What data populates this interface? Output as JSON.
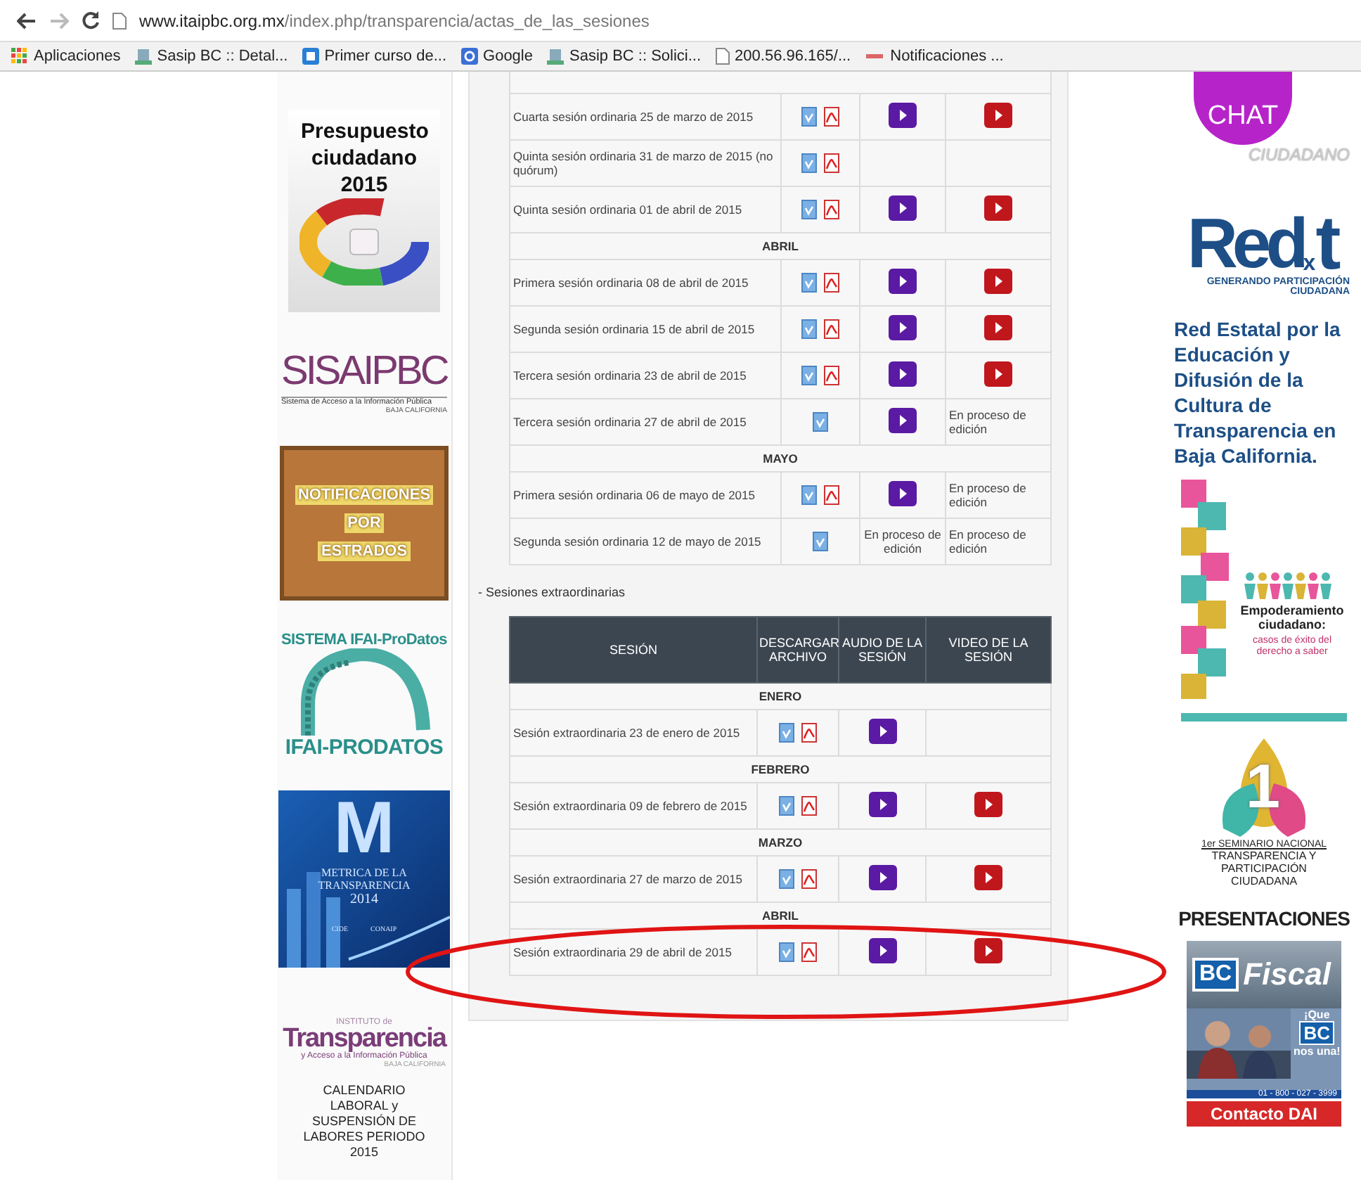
{
  "browser": {
    "url_host": "www.itaipbc.org.mx",
    "url_path": "/index.php/transparencia/actas_de_las_sesiones",
    "bookmarks": [
      {
        "label": "Aplicaciones",
        "kind": "apps"
      },
      {
        "label": "Sasip BC :: Detal...",
        "kind": "site"
      },
      {
        "label": "Primer curso de...",
        "kind": "gift"
      },
      {
        "label": "Google",
        "kind": "google"
      },
      {
        "label": "Sasip BC :: Solici...",
        "kind": "site"
      },
      {
        "label": "200.56.96.165/...",
        "kind": "page"
      },
      {
        "label": "Notificaciones ...",
        "kind": "pink"
      }
    ]
  },
  "left_sidebar": [
    {
      "kind": "budget",
      "texts": [
        "Presupuesto ciudadano 2015"
      ]
    },
    {
      "kind": "sisai",
      "texts": [
        "SISAIPBC",
        "Sistema de Acceso a la Información Pública",
        "BAJA CALIFORNIA"
      ]
    },
    {
      "kind": "board",
      "texts": [
        "NOTIFICACIONES",
        "POR",
        "ESTRADOS"
      ]
    },
    {
      "kind": "ifai",
      "texts": [
        "SISTEMA IFAI-ProDatos",
        "IFAI-PRODATOS"
      ]
    },
    {
      "kind": "metric",
      "texts": [
        "M",
        "METRICA DE LA TRANSPARENCIA",
        "2014",
        "CIDE",
        "CONAIP"
      ]
    },
    {
      "kind": "transparency",
      "texts": [
        "INSTITUTO de",
        "Transparencia",
        "y Acceso a la Información Pública",
        "BAJA CALIFORNIA"
      ]
    },
    {
      "kind": "calendar",
      "texts": [
        "CALENDARIO LABORAL y SUSPENSIÓN DE LABORES PERIODO 2015"
      ]
    }
  ],
  "ordinary_sessions": {
    "rows": [
      {
        "kind": "session",
        "text": "Cuarta sesión ordinaria 25 de marzo de 2015",
        "word": true,
        "pdf": true,
        "audio": {
          "kind": "play"
        },
        "video": {
          "kind": "play"
        }
      },
      {
        "kind": "session",
        "text": "Quinta sesión ordinaria 31 de marzo de 2015 (no quórum)",
        "word": true,
        "pdf": true
      },
      {
        "kind": "session",
        "text": "Quinta sesión ordinaria 01 de abril de 2015",
        "word": true,
        "pdf": true,
        "audio": {
          "kind": "play"
        },
        "video": {
          "kind": "play"
        }
      },
      {
        "kind": "month",
        "text": "ABRIL"
      },
      {
        "kind": "session",
        "text": "Primera sesión ordinaria 08 de abril de 2015",
        "word": true,
        "pdf": true,
        "audio": {
          "kind": "play"
        },
        "video": {
          "kind": "play"
        }
      },
      {
        "kind": "session",
        "text": "Segunda sesión ordinaria 15 de abril de 2015",
        "word": true,
        "pdf": true,
        "audio": {
          "kind": "play"
        },
        "video": {
          "kind": "play"
        }
      },
      {
        "kind": "session",
        "text": "Tercera sesión ordinaria 23 de abril de 2015",
        "word": true,
        "pdf": true,
        "audio": {
          "kind": "play"
        },
        "video": {
          "kind": "play"
        }
      },
      {
        "kind": "session",
        "text": "Tercera sesión ordinaria 27 de abril de 2015",
        "word": true,
        "pdf": false,
        "audio": {
          "kind": "play"
        },
        "video": {
          "kind": "text",
          "text": "En proceso de edición"
        }
      },
      {
        "kind": "month",
        "text": "MAYO"
      },
      {
        "kind": "session",
        "text": "Primera sesión ordinaria 06 de mayo de 2015",
        "word": true,
        "pdf": true,
        "audio": {
          "kind": "play"
        },
        "video": {
          "kind": "text",
          "text": "En proceso de edición"
        }
      },
      {
        "kind": "session",
        "text": "Segunda sesión ordinaria 12 de mayo de 2015",
        "word": true,
        "pdf": false,
        "audio": {
          "kind": "text",
          "text": "En proceso de edición"
        },
        "video": {
          "kind": "text",
          "text": "En proceso de edición"
        }
      }
    ]
  },
  "extraordinary_sessions": {
    "title": "- Sesiones extraordinarias",
    "columns": [
      "SESIÓN",
      "DESCARGAR ARCHIVO",
      "AUDIO DE LA SESIÓN",
      "VIDEO DE LA SESIÓN"
    ],
    "rows": [
      {
        "kind": "month",
        "text": "ENERO"
      },
      {
        "kind": "session",
        "text": "Sesión extraordinaria 23 de enero de 2015",
        "word": true,
        "pdf": true,
        "audio": {
          "kind": "play"
        }
      },
      {
        "kind": "month",
        "text": "FEBRERO"
      },
      {
        "kind": "session",
        "text": "Sesión extraordinaria 09 de febrero de 2015",
        "word": true,
        "pdf": true,
        "audio": {
          "kind": "play"
        },
        "video": {
          "kind": "play"
        }
      },
      {
        "kind": "month",
        "text": "MARZO"
      },
      {
        "kind": "session",
        "text": "Sesión extraordinaria 27 de marzo de 2015",
        "word": true,
        "pdf": true,
        "audio": {
          "kind": "play"
        },
        "video": {
          "kind": "play"
        }
      },
      {
        "kind": "month",
        "text": "ABRIL"
      },
      {
        "kind": "session",
        "text": "Sesión extraordinaria 29 de abril de 2015",
        "word": true,
        "pdf": true,
        "audio": {
          "kind": "play"
        },
        "video": {
          "kind": "play"
        }
      }
    ]
  },
  "highlight": {
    "kind": "ellipse"
  },
  "right_sidebar": [
    {
      "kind": "chat",
      "texts": [
        "CHAT",
        "CIUDADANO"
      ]
    },
    {
      "kind": "redxt",
      "texts": [
        "Red",
        "x",
        "t",
        "GENERANDO PARTICIPACIÓN CIUDADANA"
      ]
    },
    {
      "kind": "paragraph",
      "texts": [
        "Red Estatal por la Educación y Difusión de la Cultura de Transparencia en Baja California."
      ]
    },
    {
      "kind": "poster",
      "texts": [
        "Empoderamiento ciudadano:",
        "casos de éxito del derecho a saber"
      ]
    },
    {
      "kind": "seminar",
      "texts": [
        "1",
        "1er SEMINARIO NACIONAL",
        "TRANSPARENCIA Y PARTICIPACIÓN CIUDADANA"
      ]
    },
    {
      "kind": "heading",
      "texts": [
        "PRESENTACIONES"
      ]
    },
    {
      "kind": "fiscal",
      "texts": [
        "BC",
        "Fiscal"
      ]
    },
    {
      "texts": [
        "¡Que",
        "BC",
        "nos una!",
        "01 - 800 - 027 - 3999"
      ]
    },
    {
      "kind": "contact",
      "texts": [
        "Contacto DAI"
      ]
    }
  ]
}
